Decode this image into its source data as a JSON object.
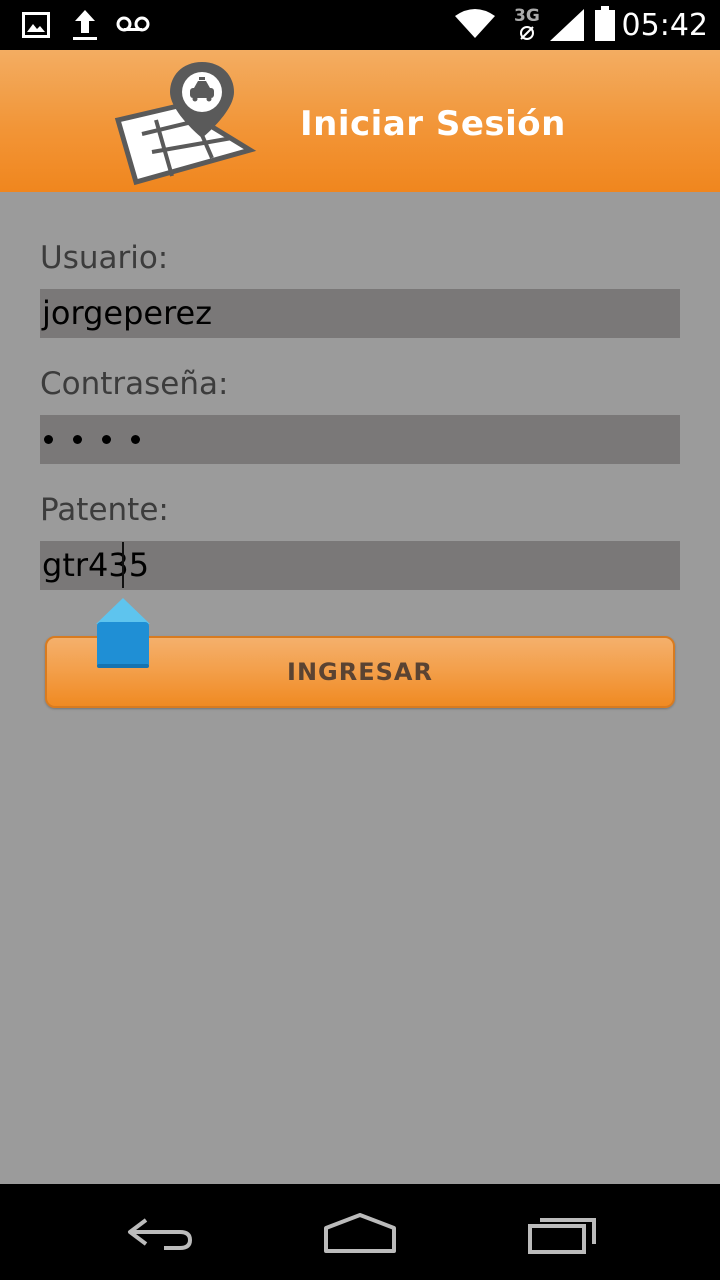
{
  "status_bar": {
    "time": "05:42",
    "network_type": "3G",
    "icons": [
      "image-icon",
      "upload-icon",
      "voicemail-icon",
      "wifi-icon",
      "signal-icon",
      "battery-icon"
    ]
  },
  "header": {
    "title": "Iniciar Sesión",
    "logo_icon": "taxi-map-pin-icon"
  },
  "form": {
    "usuario_label": "Usuario:",
    "usuario_value": "jorgeperez",
    "contrasena_label": "Contraseña:",
    "contrasena_length": 4,
    "patente_label": "Patente:",
    "patente_value": "gtr435",
    "submit_label": "INGRESAR"
  },
  "colors": {
    "header_orange": "#f29537",
    "background_gray": "#9b9b9b",
    "input_gray": "#7a7878",
    "handle_blue": "#1f8fd5"
  },
  "nav_bar": {
    "icons": [
      "back-icon",
      "home-icon",
      "recents-icon"
    ]
  }
}
